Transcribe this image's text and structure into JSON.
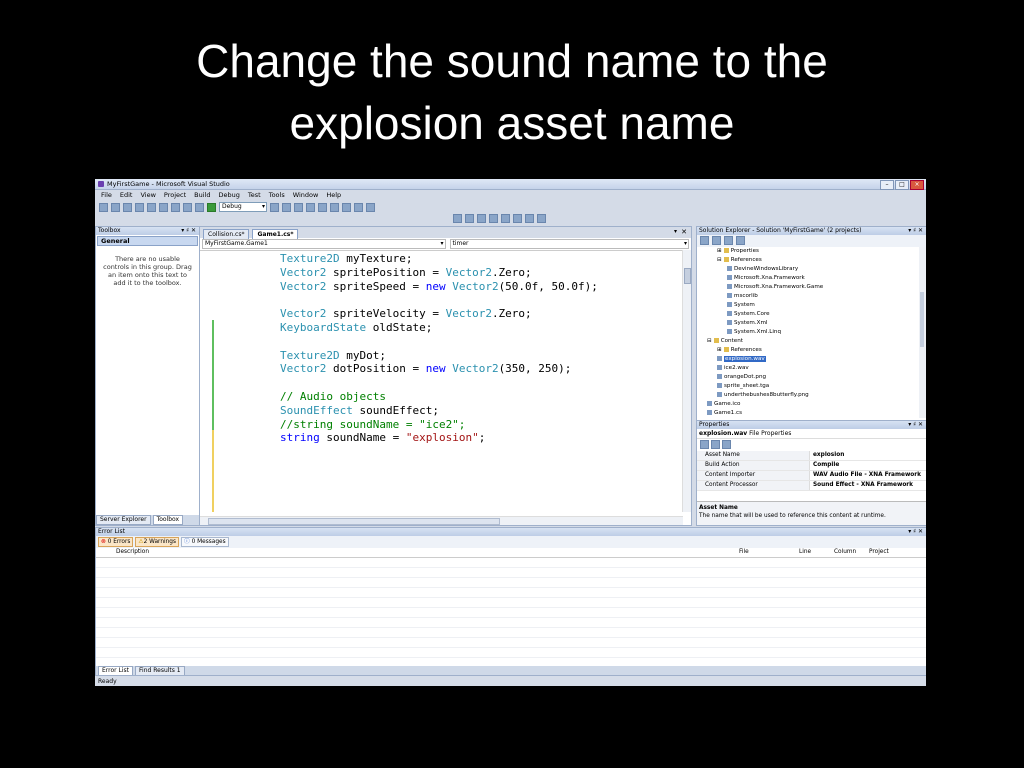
{
  "slide": {
    "title_line1": "Change the sound name to the",
    "title_line2": "explosion asset name"
  },
  "window": {
    "title": "MyFirstGame - Microsoft Visual Studio"
  },
  "menu": [
    "File",
    "Edit",
    "View",
    "Project",
    "Build",
    "Debug",
    "Test",
    "Tools",
    "Window",
    "Help"
  ],
  "toolbar": {
    "config": "Debug"
  },
  "toolbox": {
    "title": "Toolbox",
    "pins": "▾ ♯ ✕",
    "group": "General",
    "hint": "There are no usable controls in this group. Drag an item onto this text to add it to the toolbox.",
    "tabs": [
      "Server Explorer",
      "Toolbox"
    ]
  },
  "editor": {
    "tabs": [
      "Collision.cs*",
      "Game1.cs*"
    ],
    "close_glyph": "✕",
    "down_glyph": "▾",
    "class_combo": "MyFirstGame.Game1",
    "member_combo": "timer",
    "code": [
      [
        {
          "t": "Texture2D",
          "c": "ty"
        },
        {
          "t": " myTexture;"
        }
      ],
      [
        {
          "t": "Vector2",
          "c": "ty"
        },
        {
          "t": " spritePosition = "
        },
        {
          "t": "Vector2",
          "c": "ty"
        },
        {
          "t": ".Zero;"
        }
      ],
      [
        {
          "t": "Vector2",
          "c": "ty"
        },
        {
          "t": " spriteSpeed = "
        },
        {
          "t": "new",
          "c": "kw"
        },
        {
          "t": " "
        },
        {
          "t": "Vector2",
          "c": "ty"
        },
        {
          "t": "(50.0f, 50.0f);"
        }
      ],
      [],
      [
        {
          "t": "Vector2",
          "c": "ty"
        },
        {
          "t": " spriteVelocity = "
        },
        {
          "t": "Vector2",
          "c": "ty"
        },
        {
          "t": ".Zero;"
        }
      ],
      [
        {
          "t": "KeyboardState",
          "c": "ty"
        },
        {
          "t": " oldState;"
        }
      ],
      [],
      [
        {
          "t": "Texture2D",
          "c": "ty"
        },
        {
          "t": " myDot;"
        }
      ],
      [
        {
          "t": "Vector2",
          "c": "ty"
        },
        {
          "t": " dotPosition = "
        },
        {
          "t": "new",
          "c": "kw"
        },
        {
          "t": " "
        },
        {
          "t": "Vector2",
          "c": "ty"
        },
        {
          "t": "(350, 250);"
        }
      ],
      [],
      [
        {
          "t": "// Audio objects",
          "c": "cm"
        }
      ],
      [
        {
          "t": "SoundEffect",
          "c": "ty"
        },
        {
          "t": " soundEffect;"
        }
      ],
      [
        {
          "t": "//string soundName = \"ice2\";",
          "c": "cm"
        }
      ],
      [
        {
          "t": "string",
          "c": "kw"
        },
        {
          "t": " soundName = "
        },
        {
          "t": "\"explosion\"",
          "c": "st"
        },
        {
          "t": ";"
        }
      ]
    ]
  },
  "solution_explorer": {
    "title": "Solution Explorer - Solution 'MyFirstGame' (2 projects)",
    "pins": "▾ ♯ ✕",
    "items": [
      {
        "label": "Properties",
        "level": 1,
        "folder": true,
        "exp": "⊞"
      },
      {
        "label": "References",
        "level": 1,
        "folder": true,
        "exp": "⊟"
      },
      {
        "label": "DevineWindowsLibrary",
        "level": 2
      },
      {
        "label": "Microsoft.Xna.Framework",
        "level": 2
      },
      {
        "label": "Microsoft.Xna.Framework.Game",
        "level": 2
      },
      {
        "label": "mscorlib",
        "level": 2
      },
      {
        "label": "System",
        "level": 2
      },
      {
        "label": "System.Core",
        "level": 2
      },
      {
        "label": "System.Xml",
        "level": 2
      },
      {
        "label": "System.Xml.Linq",
        "level": 2
      },
      {
        "label": "Content",
        "level": 0,
        "folder": true,
        "exp": "⊟"
      },
      {
        "label": "References",
        "level": 1,
        "folder": true,
        "exp": "⊞"
      },
      {
        "label": "explosion.wav",
        "level": 1,
        "selected": true
      },
      {
        "label": "ice2.wav",
        "level": 1
      },
      {
        "label": "orangeDot.png",
        "level": 1
      },
      {
        "label": "sprite_sheet.tga",
        "level": 1
      },
      {
        "label": "underthebushes8butterfly.png",
        "level": 1
      },
      {
        "label": "Game.ico",
        "level": 0
      },
      {
        "label": "Game1.cs",
        "level": 0
      }
    ]
  },
  "properties": {
    "title": "Properties",
    "pins": "▾ ♯ ✕",
    "object": "explosion.wav",
    "object_type": "File Properties",
    "rows": [
      {
        "k": "Asset Name",
        "v": "explosion"
      },
      {
        "k": "Build Action",
        "v": "Compile"
      },
      {
        "k": "Content Importer",
        "v": "WAV Audio File - XNA Framework"
      },
      {
        "k": "Content Processor",
        "v": "Sound Effect - XNA Framework"
      }
    ],
    "desc_title": "Asset Name",
    "desc_text": "The name that will be used to reference this content at runtime."
  },
  "error_list": {
    "title": "Error List",
    "pins": "▾ ♯ ✕",
    "filters": [
      "0 Errors",
      "2 Warnings",
      "0 Messages"
    ],
    "columns": [
      "Description",
      "File",
      "Line",
      "Column",
      "Project"
    ],
    "tabs": [
      "Error List",
      "Find Results 1"
    ]
  },
  "status": "Ready",
  "colors": {
    "keyword": "#0000ff",
    "type": "#2b91af",
    "comment": "#008000",
    "string": "#a31515"
  }
}
